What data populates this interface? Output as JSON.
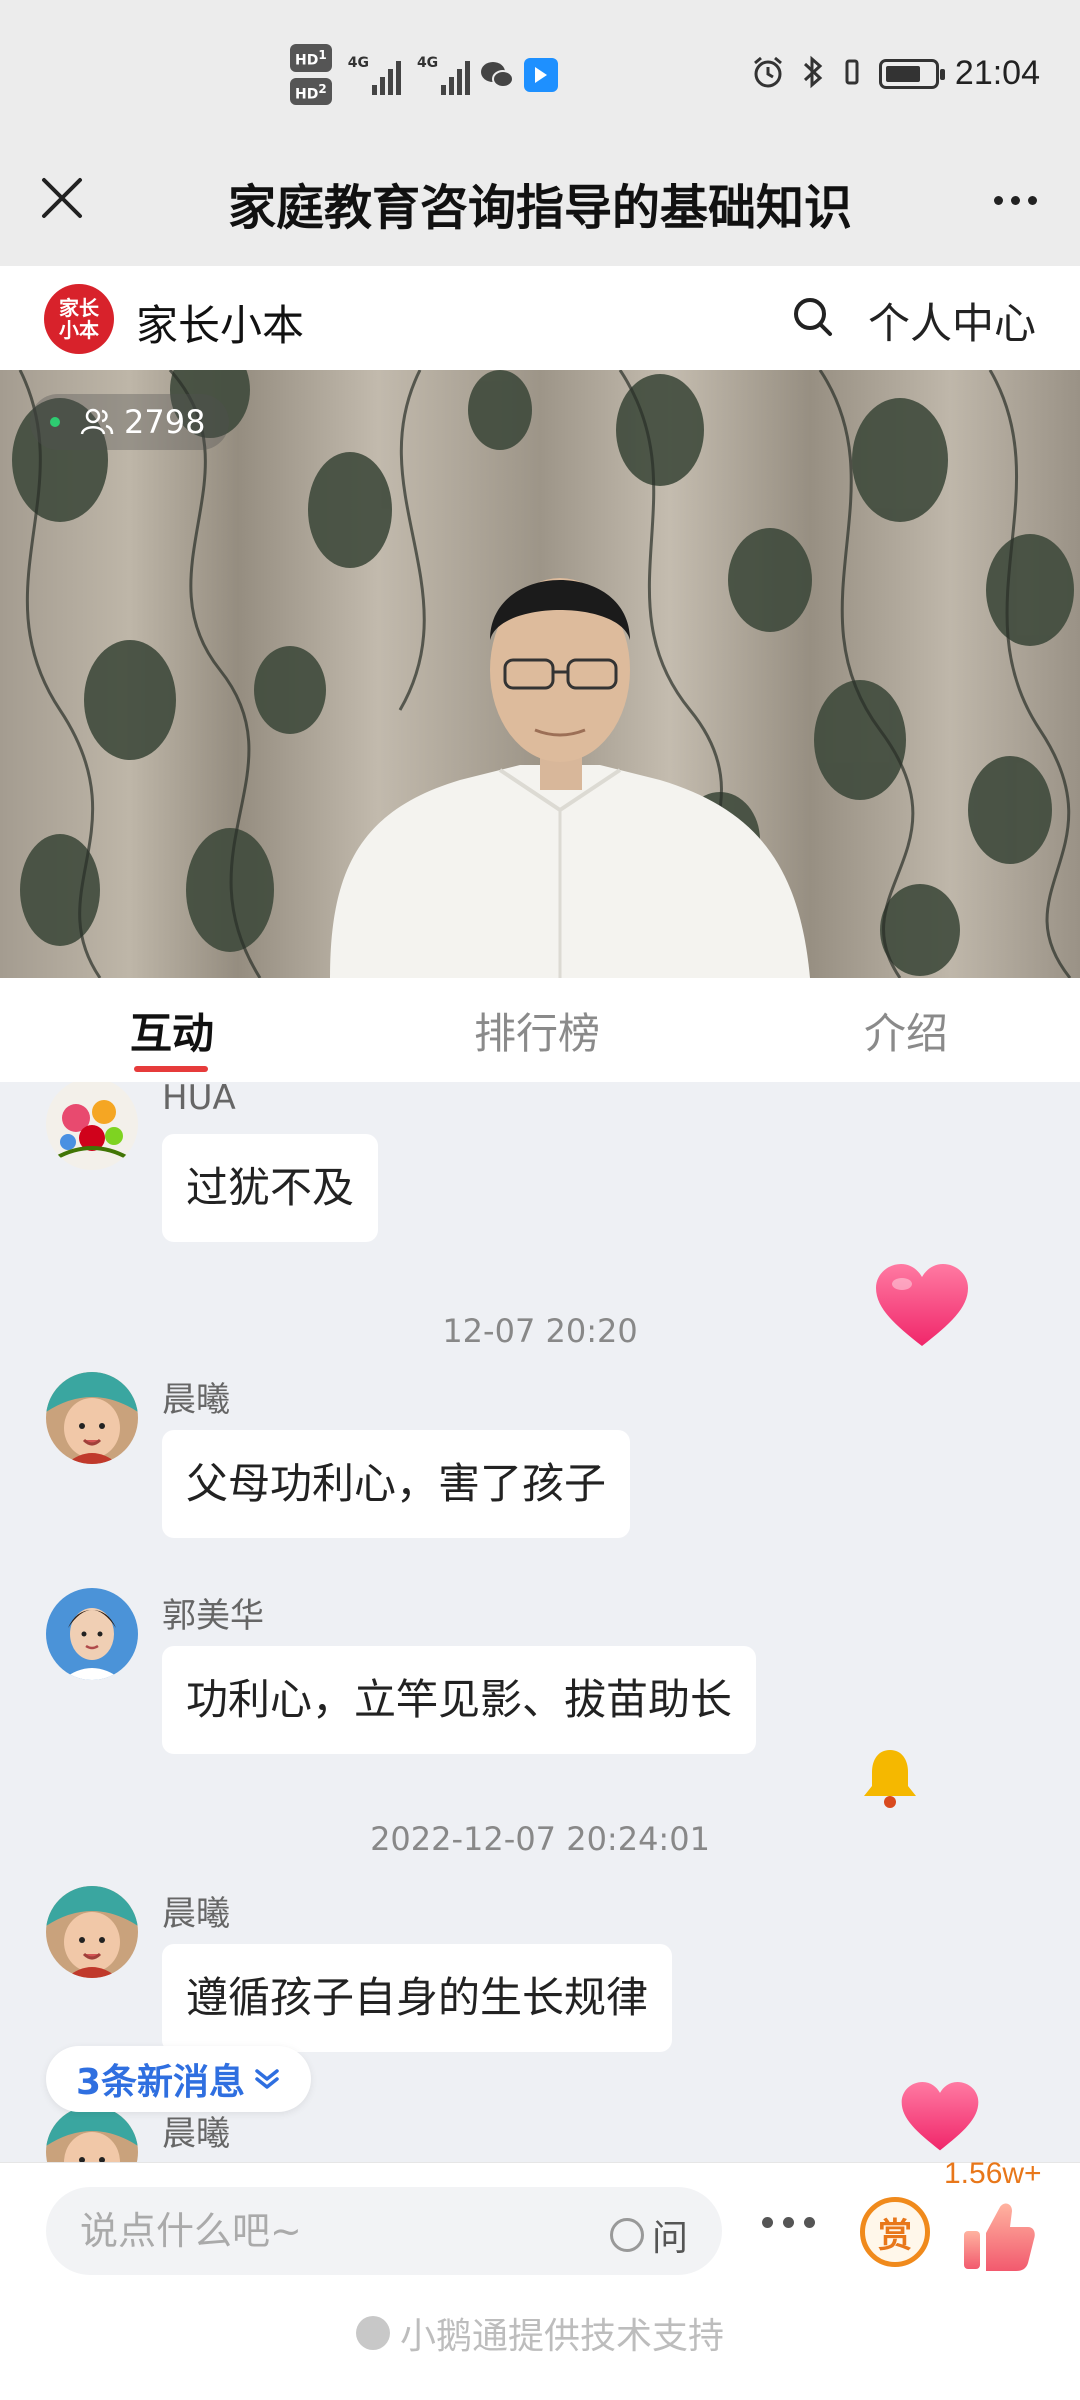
{
  "status_bar": {
    "sim1": "HD",
    "sim1_index": "1",
    "sim2": "HD",
    "sim2_index": "2",
    "net1": "4G",
    "net2": "4G",
    "time": "21:04"
  },
  "titlebar": {
    "title": "家庭教育咨询指导的基础知识"
  },
  "shop": {
    "logo_text": "家长小本",
    "name": "家长小本",
    "profile_label": "个人中心"
  },
  "video": {
    "viewer_count": "2798"
  },
  "tabs": [
    {
      "label": "互动",
      "active": true
    },
    {
      "label": "排行榜",
      "active": false
    },
    {
      "label": "介绍",
      "active": false
    }
  ],
  "chat": {
    "messages": [
      {
        "user": "HUA",
        "text": "过犹不及"
      },
      {
        "timestamp": "12-07 20:20"
      },
      {
        "user": "晨曦",
        "text": "父母功利心，害了孩子"
      },
      {
        "user": "郭美华",
        "text": "功利心，立竿见影、拔苗助长"
      },
      {
        "timestamp": "2022-12-07 20:24:01"
      },
      {
        "user": "晨曦",
        "text": "遵循孩子自身的生长规律"
      },
      {
        "user": "晨曦",
        "text": ""
      }
    ],
    "new_messages_label": "3条新消息"
  },
  "bottom": {
    "input_placeholder": "说点什么吧~",
    "ask_label": "问",
    "reward_label": "赏",
    "like_count": "1.56w+",
    "support_text": "小鹅通提供技术支持"
  },
  "colors": {
    "accent_red": "#e63b3b",
    "new_msg_blue": "#2f6fe0",
    "reward_orange": "#f08a1c",
    "heart_pink": "#f2407a"
  }
}
